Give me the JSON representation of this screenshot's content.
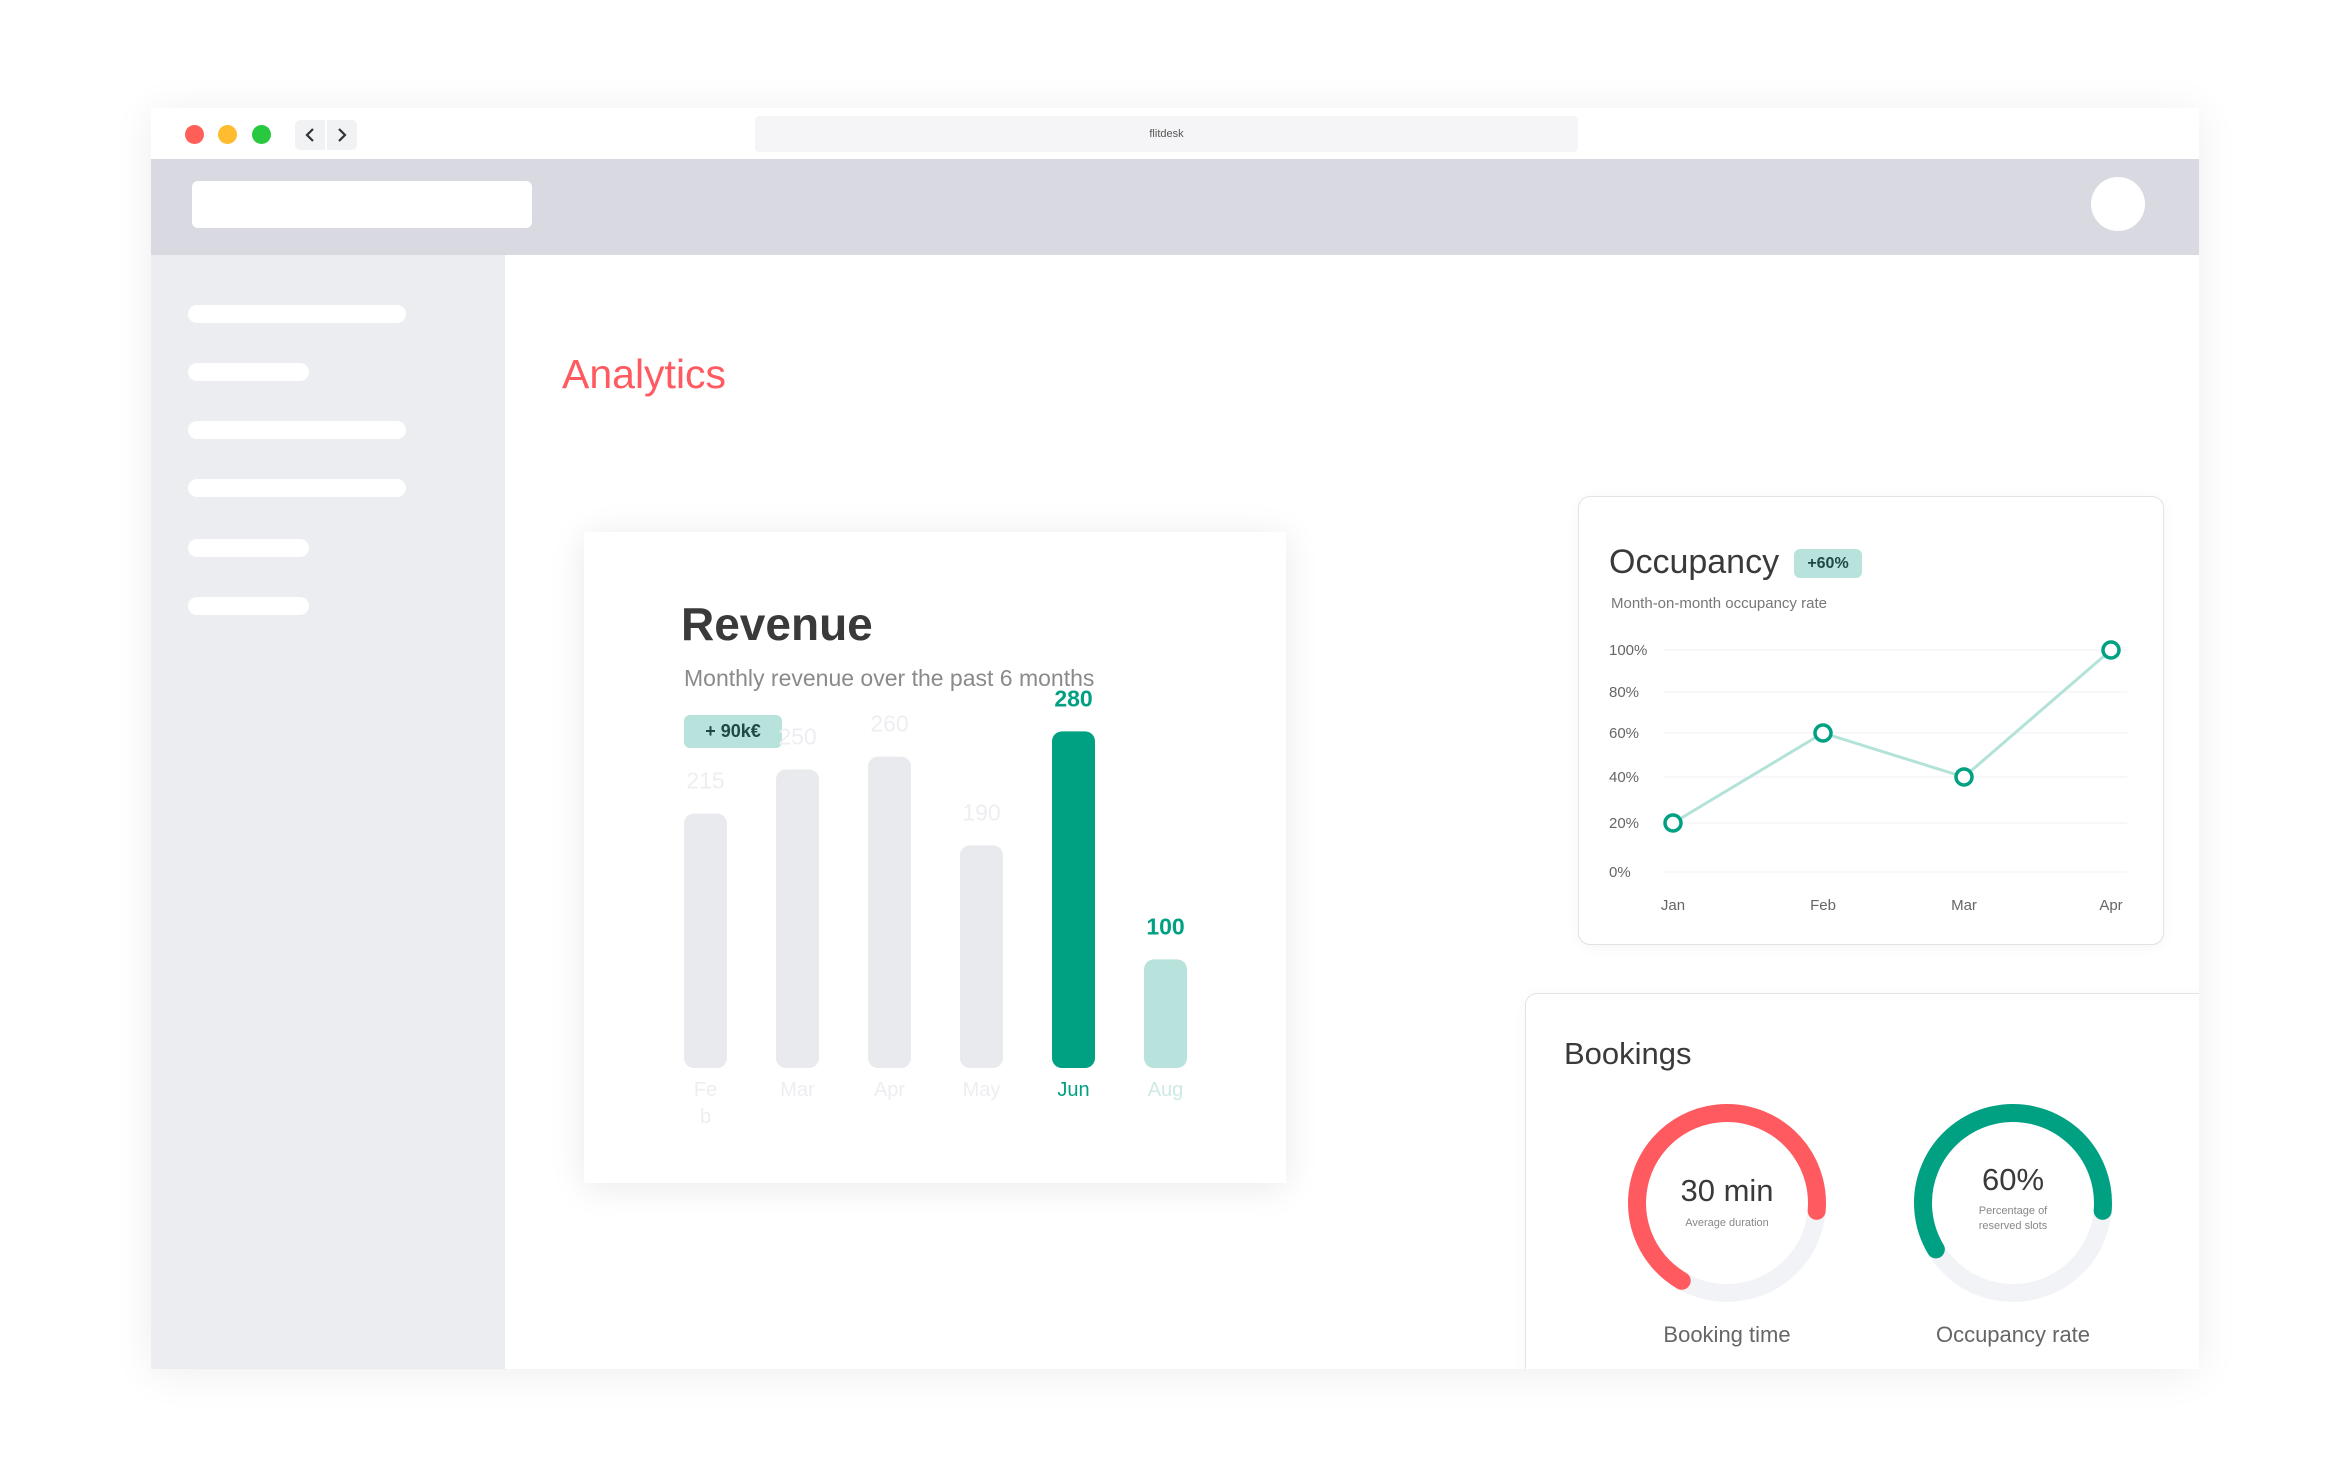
{
  "browser": {
    "url": "flitdesk"
  },
  "page": {
    "title": "Analytics"
  },
  "colors": {
    "accent": "#ff5a5f",
    "teal": "#00a082",
    "teal_light": "#b8e3dc",
    "bar_muted": "#e9eaee"
  },
  "revenue": {
    "title": "Revenue",
    "subtitle": "Monthly revenue over the past 6 months",
    "badge": "+ 90k€"
  },
  "occupancy": {
    "title": "Occupancy",
    "badge": "+60%",
    "subtitle": "Month-on-month occupancy rate"
  },
  "bookings": {
    "title": "Bookings",
    "booking_time": {
      "value": "30 min",
      "caption": "Average duration",
      "label": "Booking time",
      "fraction": 0.68
    },
    "occupancy_rate": {
      "value": "60%",
      "caption_line1": "Percentage of",
      "caption_line2": "reserved slots",
      "label": "Occupancy rate",
      "fraction": 0.6
    }
  },
  "chart_data": [
    {
      "type": "bar",
      "title": "Revenue",
      "categories": [
        "Feb",
        "Mar",
        "Apr",
        "May",
        "Jun",
        "Aug"
      ],
      "category_labels": [
        "Fe\nb",
        "Mar",
        "Apr",
        "May",
        "Jun",
        "Aug"
      ],
      "values": [
        215,
        250,
        260,
        190,
        280,
        100
      ],
      "highlight": [
        "none",
        "none",
        "none",
        "none",
        "strong",
        "light"
      ],
      "ylim": [
        0,
        300
      ]
    },
    {
      "type": "line",
      "title": "Occupancy",
      "x": [
        "Jan",
        "Feb",
        "Mar",
        "Apr"
      ],
      "y": [
        20,
        60,
        40,
        100
      ],
      "yticks": [
        "0%",
        "20%",
        "40%",
        "60%",
        "80%",
        "100%"
      ],
      "ylim": [
        0,
        100
      ],
      "grid": true
    }
  ]
}
